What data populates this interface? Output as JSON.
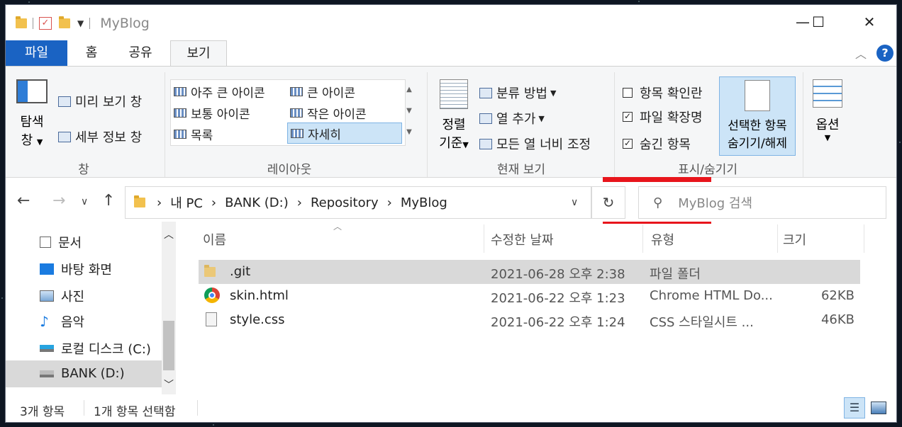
{
  "window": {
    "title": "MyBlog"
  },
  "tabs": [
    {
      "label": "파일"
    },
    {
      "label": "홈"
    },
    {
      "label": "공유"
    },
    {
      "label": "보기"
    }
  ],
  "ribbon": {
    "pane": {
      "nav_pane_line1": "탐색",
      "nav_pane_line2": "창",
      "preview": "미리 보기 창",
      "details": "세부 정보 창",
      "group": "창"
    },
    "layout": {
      "items": [
        "아주 큰 아이콘",
        "큰 아이콘",
        "보통 아이콘",
        "작은 아이콘",
        "목록",
        "자세히"
      ],
      "group": "레이아웃"
    },
    "current_view": {
      "sort_line1": "정렬",
      "sort_line2": "기준",
      "group_by": "분류 방법",
      "add_columns": "열 추가",
      "size_all": "모든 열 너비 조정",
      "group": "현재 보기"
    },
    "show_hide": {
      "item_checkboxes": "항목 확인란",
      "file_extensions": "파일 확장명",
      "hidden_items": "숨긴 항목",
      "hide_selected_line1": "선택한 항목",
      "hide_selected_line2": "숨기기/해제",
      "group": "표시/숨기기"
    },
    "options": {
      "label": "옵션"
    }
  },
  "address": {
    "crumbs": [
      "내 PC",
      "BANK (D:)",
      "Repository",
      "MyBlog"
    ],
    "search_placeholder": "MyBlog 검색"
  },
  "sidebar": {
    "items": [
      "문서",
      "바탕 화면",
      "사진",
      "음악",
      "로컬 디스크 (C:)",
      "BANK (D:)"
    ]
  },
  "columns": [
    "이름",
    "수정한 날짜",
    "유형",
    "크기"
  ],
  "files": [
    {
      "name": ".git",
      "date": "2021-06-28 오후 2:38",
      "type": "파일 폴더",
      "size": ""
    },
    {
      "name": "skin.html",
      "date": "2021-06-22 오후 1:23",
      "type": "Chrome HTML Do...",
      "size": "62KB"
    },
    {
      "name": "style.css",
      "date": "2021-06-22 오후 1:24",
      "type": "CSS 스타일시트 ...",
      "size": "46KB"
    }
  ],
  "status": {
    "count": "3개 항목",
    "selected": "1개 항목 선택함"
  },
  "colors": {
    "accent": "#1a63c3",
    "highlight": "#e8151c"
  }
}
